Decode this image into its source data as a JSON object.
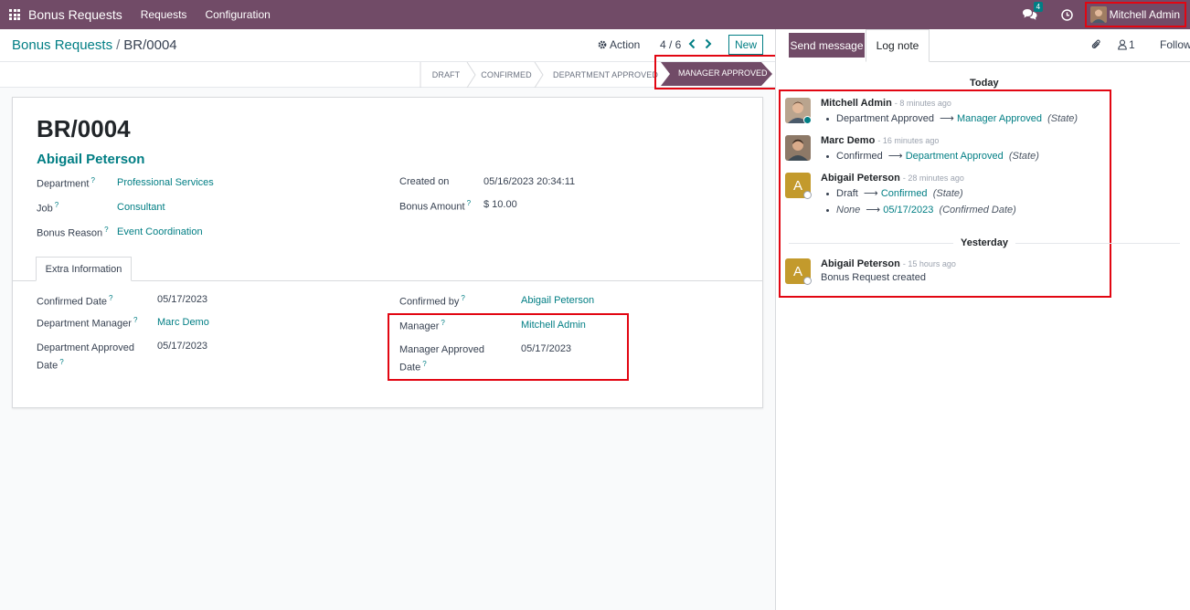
{
  "navbar": {
    "app_name": "Bonus Requests",
    "menus": [
      "Requests",
      "Configuration"
    ],
    "chat_count": "4",
    "user_name": "Mitchell Admin"
  },
  "control": {
    "breadcrumb_parent": "Bonus Requests",
    "breadcrumb_sep": "/",
    "breadcrumb_current": "BR/0004",
    "action_label": "Action",
    "pager": "4 / 6",
    "new_label": "New"
  },
  "status": {
    "stages": [
      "DRAFT",
      "CONFIRMED",
      "DEPARTMENT APPROVED",
      "MANAGER APPROVED"
    ],
    "current": "MANAGER APPROVED"
  },
  "form": {
    "record_name": "BR/0004",
    "employee": "Abigail Peterson",
    "help_mark": "?",
    "left_fields": [
      {
        "label": "Department",
        "value": "Professional Services"
      },
      {
        "label": "Job",
        "value": "Consultant"
      },
      {
        "label": "Bonus Reason",
        "value": "Event Coordination"
      }
    ],
    "right_fields": [
      {
        "label": "Created on",
        "value": "05/16/2023 20:34:11"
      },
      {
        "label": "Bonus Amount",
        "value": "$ 10.00"
      }
    ],
    "tab_label": "Extra Information",
    "extra_left": [
      {
        "label": "Confirmed Date",
        "value": "05/17/2023"
      },
      {
        "label": "Department Manager",
        "value": "Marc Demo"
      },
      {
        "label_line1": "Department Approved",
        "label_line2": "Date",
        "value": "05/17/2023"
      }
    ],
    "extra_right": [
      {
        "label": "Confirmed by",
        "value": "Abigail Peterson"
      },
      {
        "label": "Manager",
        "value": "Mitchell Admin"
      },
      {
        "label_line1": "Manager Approved",
        "label_line2": "Date",
        "value": "05/17/2023"
      }
    ]
  },
  "chatter": {
    "send_message": "Send message",
    "log_note": "Log note",
    "follower_count": "1",
    "follow": "Follow",
    "today": "Today",
    "yesterday": "Yesterday",
    "arrow": "⟶",
    "messages": [
      {
        "author": "Mitchell Admin",
        "time": "- 8 minutes ago",
        "changes": [
          {
            "old": "Department Approved",
            "new": "Manager Approved",
            "field": "(State)"
          }
        ]
      },
      {
        "author": "Marc Demo",
        "time": "- 16 minutes ago",
        "changes": [
          {
            "old": "Confirmed",
            "new": "Department Approved",
            "field": "(State)"
          }
        ]
      },
      {
        "author": "Abigail Peterson",
        "time": "- 28 minutes ago",
        "avatar_letter": "A",
        "changes": [
          {
            "old": "Draft",
            "new": "Confirmed",
            "field": "(State)"
          },
          {
            "old": "None",
            "new": "05/17/2023",
            "field": "(Confirmed Date)"
          }
        ]
      },
      {
        "author": "Abigail Peterson",
        "time": "- 15 hours ago",
        "avatar_letter": "A",
        "body": "Bonus Request created"
      }
    ]
  },
  "colors": {
    "brand": "#714b67",
    "accent": "#017e84",
    "highlight": "#e20612"
  }
}
